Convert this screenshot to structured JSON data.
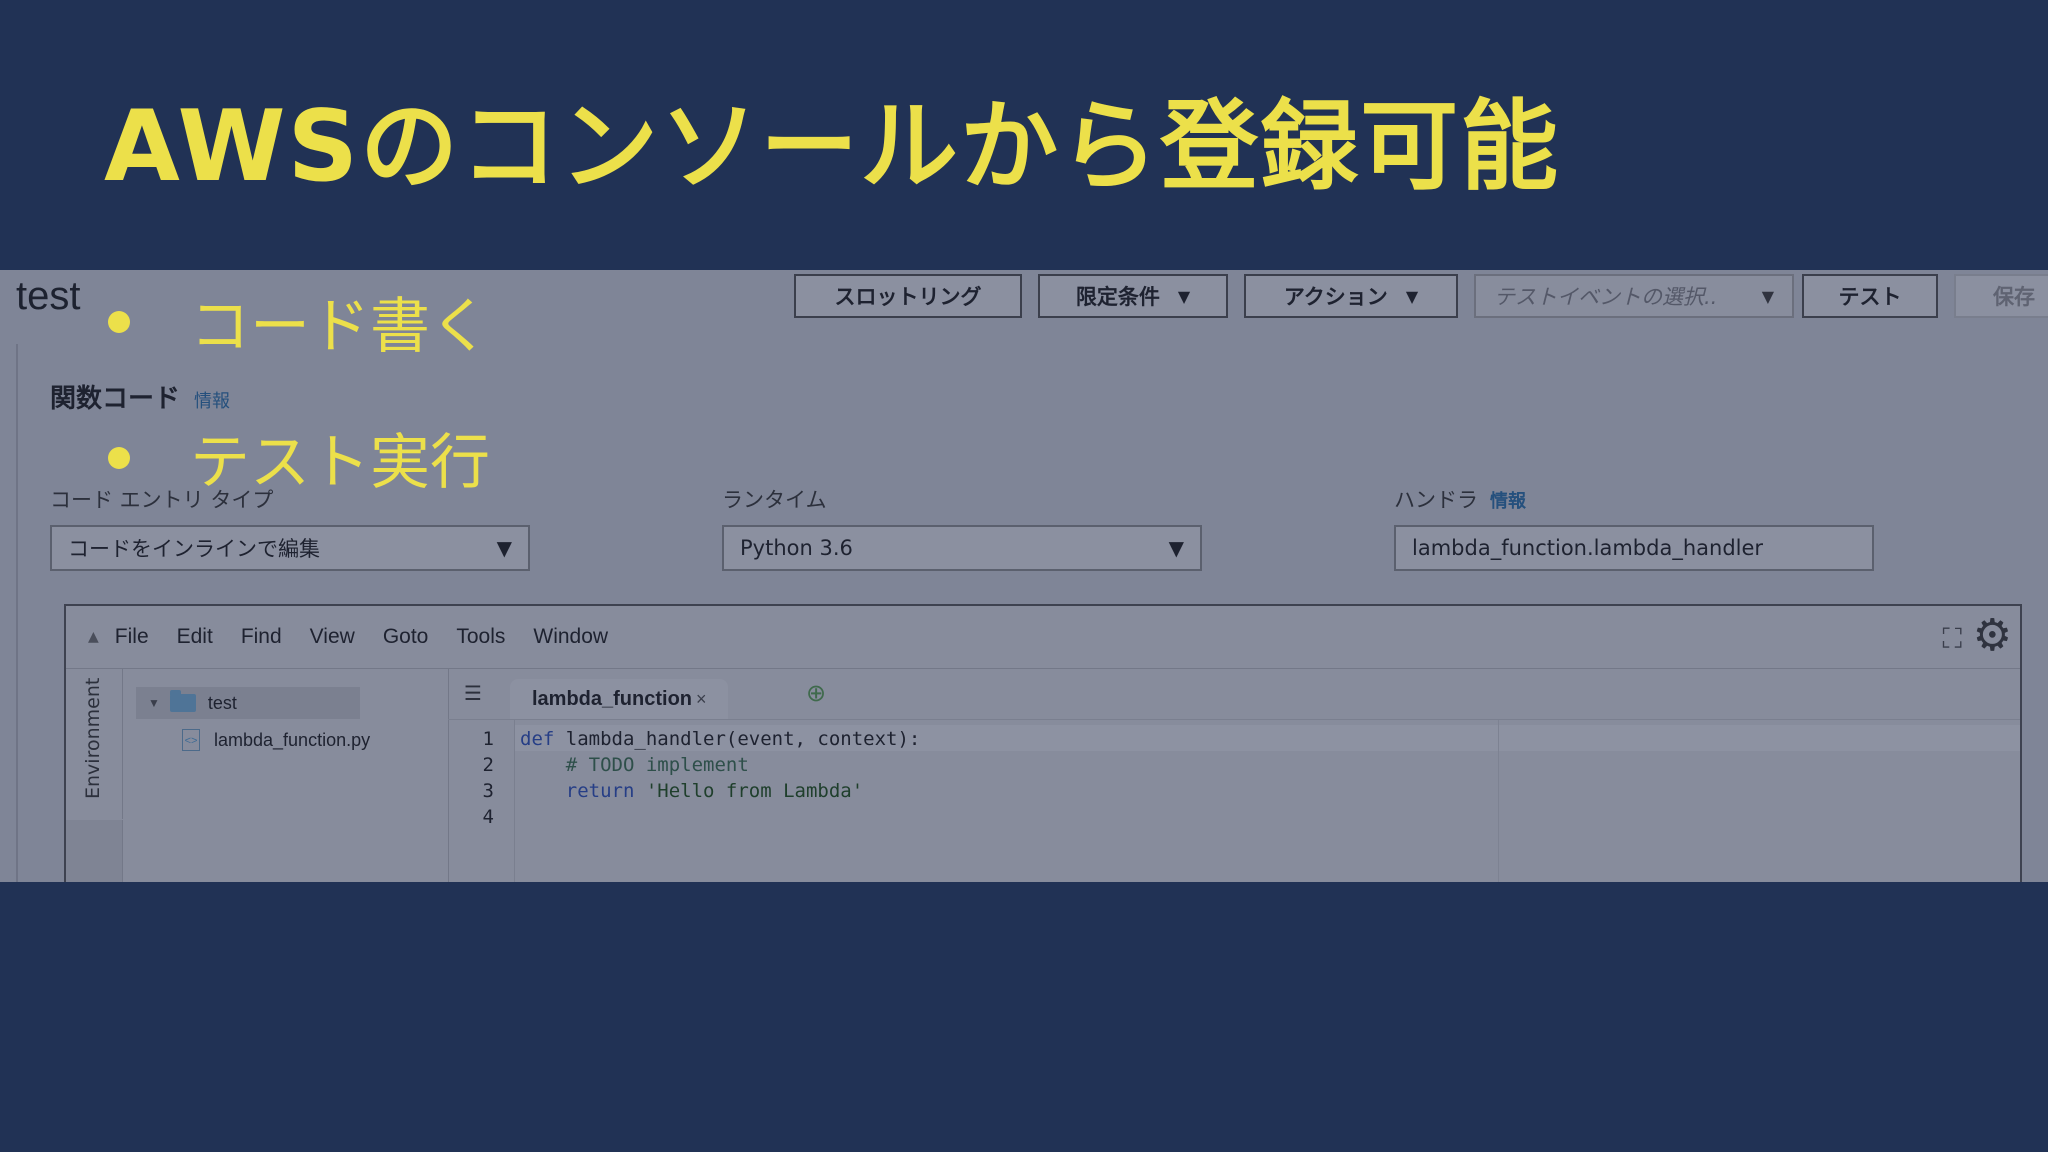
{
  "slide": {
    "title": "AWSのコンソールから登録可能",
    "bullets": [
      "コード書く",
      "テスト実行"
    ]
  },
  "console": {
    "function_name": "test",
    "toolbar": {
      "throttle": "スロットリング",
      "qualifiers": "限定条件",
      "actions": "アクション",
      "test_event_placeholder": "テストイベントの選択..",
      "test": "テスト",
      "save": "保存"
    },
    "section": {
      "title": "関数コード",
      "info": "情報"
    },
    "fields": {
      "code_entry_type": {
        "label": "コード エントリ タイプ",
        "value": "コードをインラインで編集"
      },
      "runtime": {
        "label": "ランタイム",
        "value": "Python 3.6"
      },
      "handler": {
        "label": "ハンドラ",
        "info": "情報",
        "value": "lambda_function.lambda_handler"
      }
    },
    "ide": {
      "menu": [
        "File",
        "Edit",
        "Find",
        "View",
        "Goto",
        "Tools",
        "Window"
      ],
      "environment_label": "Environment",
      "tree": {
        "root": "test",
        "file": "lambda_function.py"
      },
      "open_tab": "lambda_function",
      "line_numbers": [
        "1",
        "2",
        "3",
        "4"
      ],
      "code": {
        "l1_kw": "def",
        "l1_rest": " lambda_handler(event, context):",
        "l2": "    # TODO implement",
        "l3_indent": "    ",
        "l3_kw": "return",
        "l3_str": " 'Hello from Lambda'"
      }
    }
  },
  "colors": {
    "background": "#213255",
    "accent_yellow": "#ece04a",
    "screenshot_overlay": "#7f8597"
  },
  "icons": [
    "caret-down-icon",
    "collapse-up-icon",
    "fullscreen-icon",
    "gear-icon",
    "folder-icon",
    "python-file-icon",
    "tabs-menu-icon",
    "add-tab-icon",
    "close-tab-icon"
  ]
}
